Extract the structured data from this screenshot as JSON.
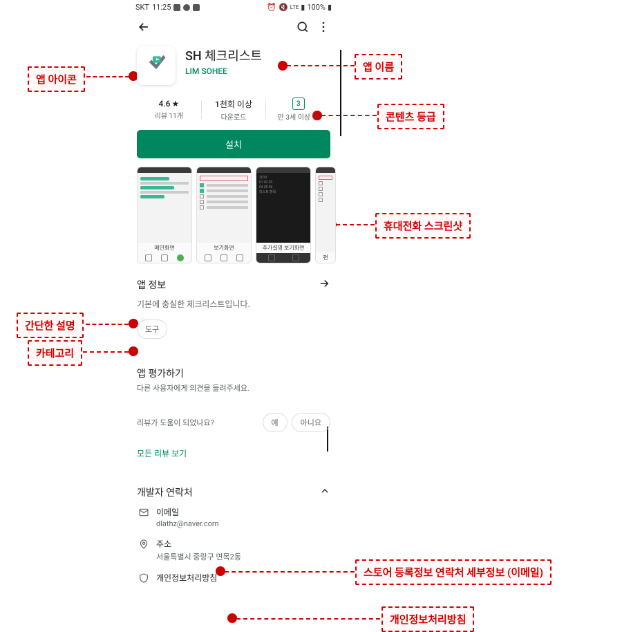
{
  "status": {
    "carrier": "SKT",
    "time": "11:25",
    "network": "LTE",
    "battery": "100%"
  },
  "app": {
    "name": "SH 체크리스트",
    "developer": "LIM SOHEE"
  },
  "stats": {
    "rating": "4.6",
    "rating_star": "★",
    "reviews": "리뷰 11개",
    "downloads_top": "1천회 이상",
    "downloads_sub": "다운로드",
    "content_rating_badge": "3",
    "content_rating_text": "만 3세 이상",
    "info_icon": "ⓘ"
  },
  "install_label": "설치",
  "screenshots": {
    "cap1": "메인화면",
    "cap2": "보기화면",
    "cap3": "추가설명 보기화면",
    "cap4": "편"
  },
  "info_section": {
    "title": "앱 정보",
    "desc": "기본에 충실한 체크리스트입니다.",
    "category_chip": "도구"
  },
  "rate": {
    "title": "앱 평가하기",
    "sub": "다른 사용자에게 의견을 들려주세요.",
    "question": "리뷰가 도움이 되었나요?",
    "yes": "예",
    "no": "아니요",
    "see_all": "모든 리뷰 보기"
  },
  "dev": {
    "title": "개발자 연락처",
    "email_label": "이메일",
    "email_value": "dlathz@naver.com",
    "address_label": "주소",
    "address_value": "서울특별시 중랑구 면목2동",
    "privacy_label": "개인정보처리방침"
  },
  "annotations": {
    "app_icon": "앱 아이콘",
    "app_name": "앱 이름",
    "content_rating": "콘텐츠 등급",
    "screenshot": "휴대전화 스크린샷",
    "short_desc": "간단한 설명",
    "category": "카테고리",
    "contact_email": "스토어 등록정보 연락처 세부정보 (이메일)",
    "privacy": "개인정보처리방침"
  }
}
